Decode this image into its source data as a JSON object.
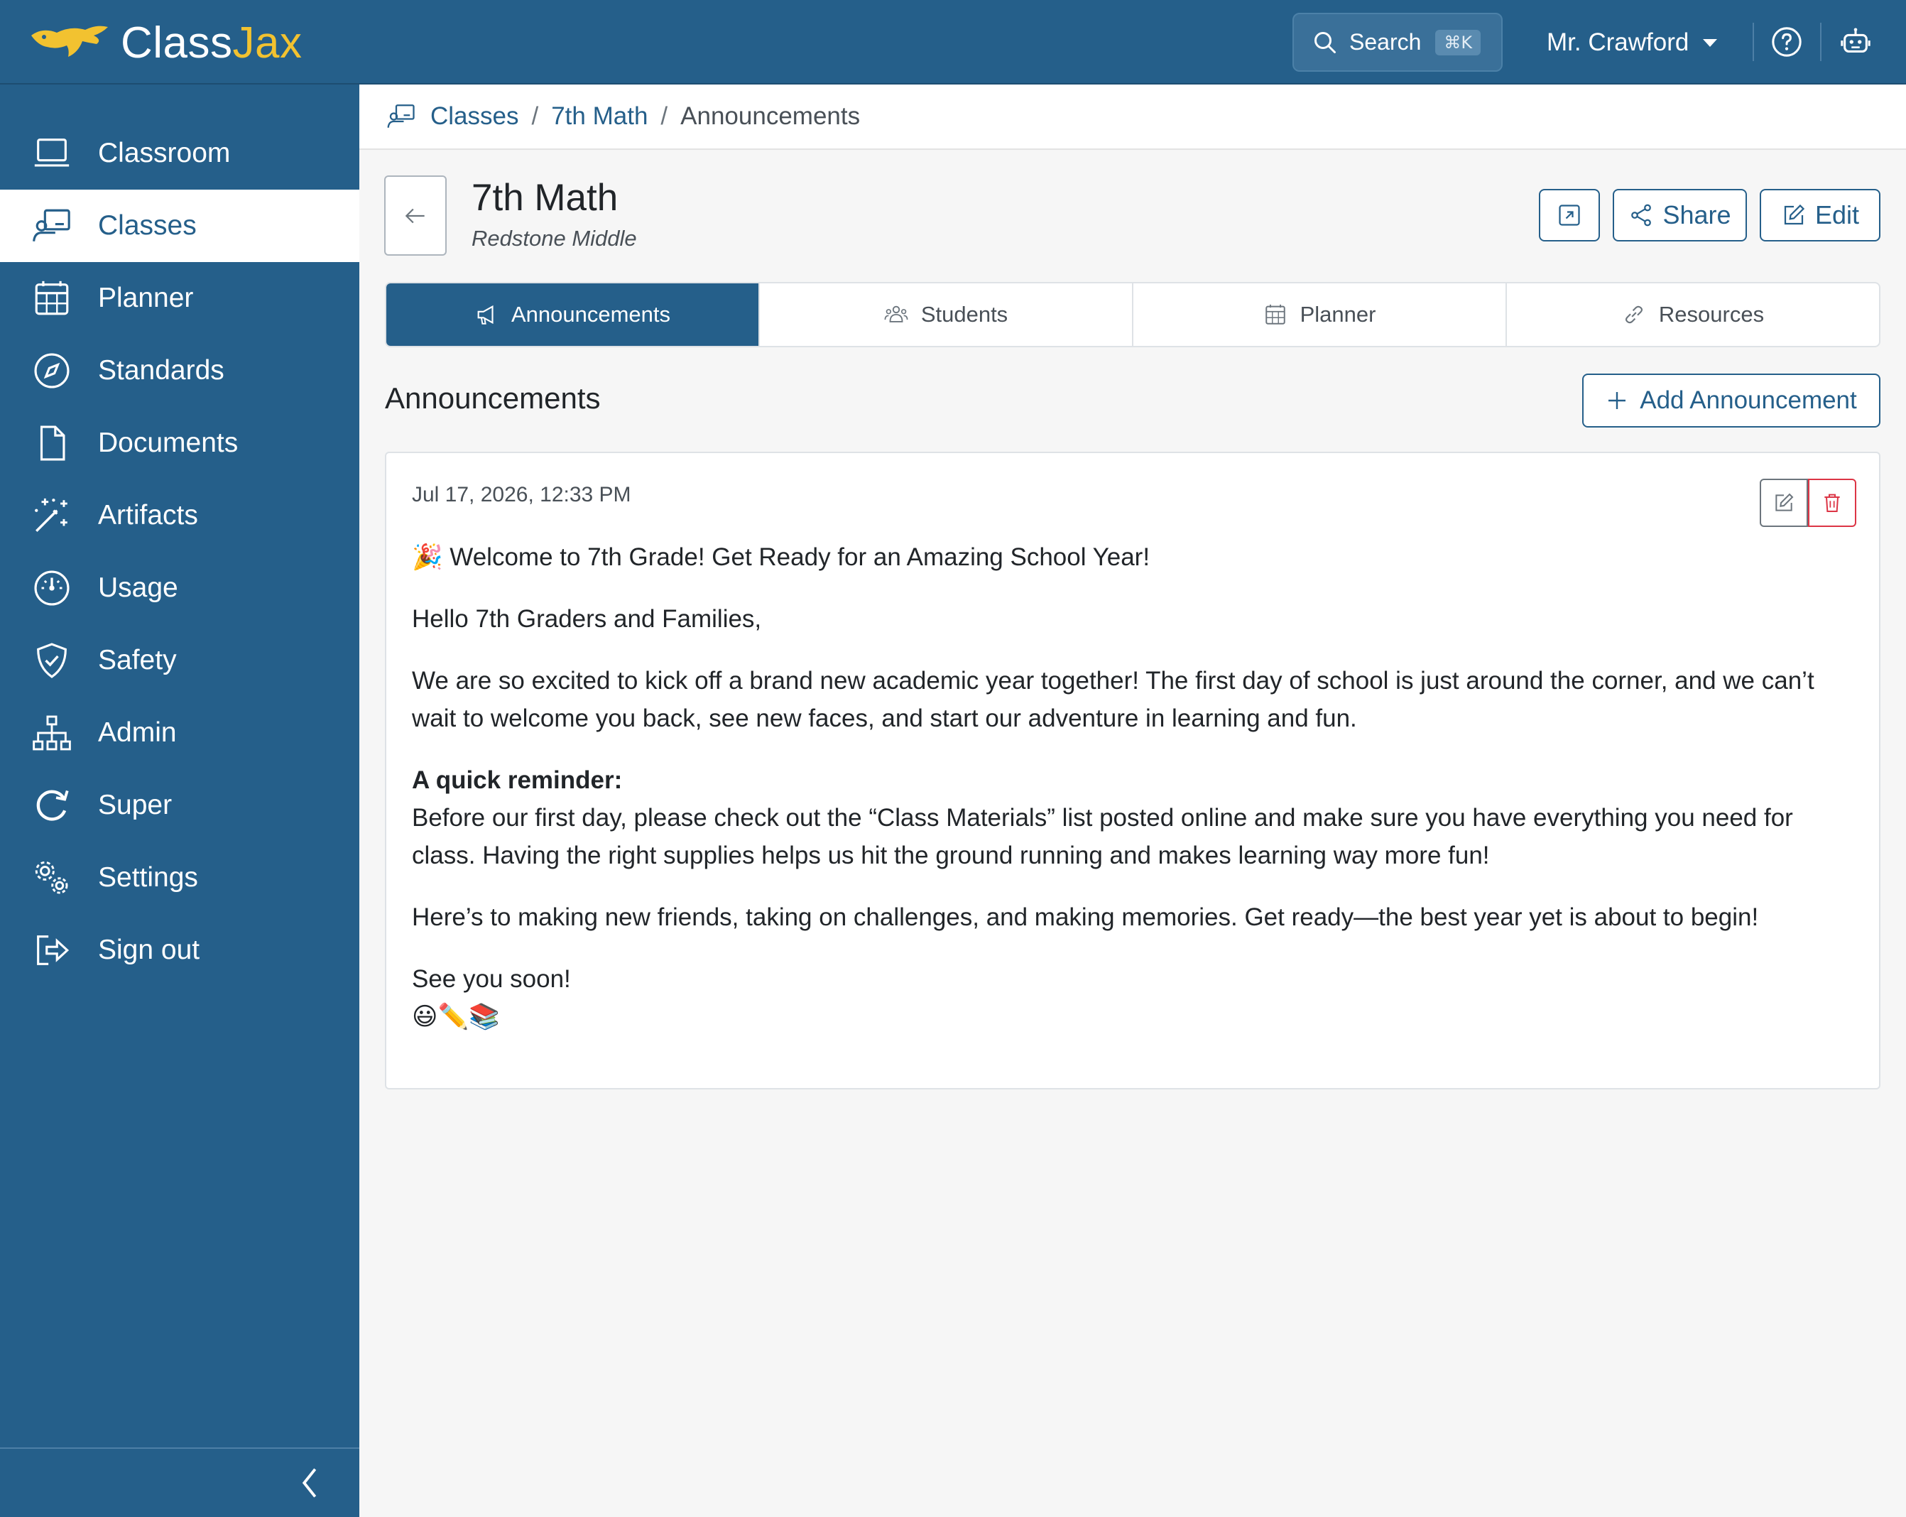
{
  "app": {
    "brand_part1": "Class",
    "brand_part2": "Jax",
    "search_label": "Search",
    "search_shortcut": "⌘K",
    "user_name": "Mr. Crawford",
    "accent_color": "#255f8a",
    "brand_yellow": "#f2c230"
  },
  "sidebar": {
    "items": [
      {
        "label": "Classroom",
        "icon": "laptop-icon"
      },
      {
        "label": "Classes",
        "icon": "teacher-board-icon",
        "active": true
      },
      {
        "label": "Planner",
        "icon": "calendar-icon"
      },
      {
        "label": "Standards",
        "icon": "compass-icon"
      },
      {
        "label": "Documents",
        "icon": "file-icon"
      },
      {
        "label": "Artifacts",
        "icon": "magic-wand-icon"
      },
      {
        "label": "Usage",
        "icon": "speedometer-icon"
      },
      {
        "label": "Safety",
        "icon": "shield-check-icon"
      },
      {
        "label": "Admin",
        "icon": "org-chart-icon"
      },
      {
        "label": "Super",
        "icon": "refresh-circle-icon"
      },
      {
        "label": "Settings",
        "icon": "gears-icon"
      },
      {
        "label": "Sign out",
        "icon": "sign-out-icon"
      }
    ]
  },
  "breadcrumb": {
    "items": [
      "Classes",
      "7th Math"
    ],
    "current": "Announcements",
    "separator": "/"
  },
  "header": {
    "title": "7th Math",
    "subtitle": "Redstone Middle",
    "share_label": "Share",
    "edit_label": "Edit"
  },
  "tabs": [
    {
      "label": "Announcements",
      "icon": "megaphone-icon",
      "active": true
    },
    {
      "label": "Students",
      "icon": "people-icon"
    },
    {
      "label": "Planner",
      "icon": "calendar-icon"
    },
    {
      "label": "Resources",
      "icon": "link-icon"
    }
  ],
  "section": {
    "title": "Announcements",
    "add_label": "Add Announcement"
  },
  "announcement": {
    "date": "Jul 17, 2026, 12:33 PM",
    "heading": "🎉 Welcome to 7th Grade! Get Ready for an Amazing School Year!",
    "greeting": "Hello 7th Graders and Families,",
    "paragraph1": "We are so excited to kick off a brand new academic year together! The first day of school is just around the corner, and we can’t wait to welcome you back, see new faces, and start our adventure in learning and fun.",
    "reminder_title": "A quick reminder:",
    "reminder_text": "Before our first day, please check out the “Class Materials” list posted online and make sure you have everything you need for class. Having the right supplies helps us hit the ground running and makes learning way more fun!",
    "paragraph2": "Here’s to making new friends, taking on challenges, and making memories. Get ready—the best year yet is about to begin!",
    "signoff": "See you soon!",
    "emojis": "😃✏️📚"
  }
}
